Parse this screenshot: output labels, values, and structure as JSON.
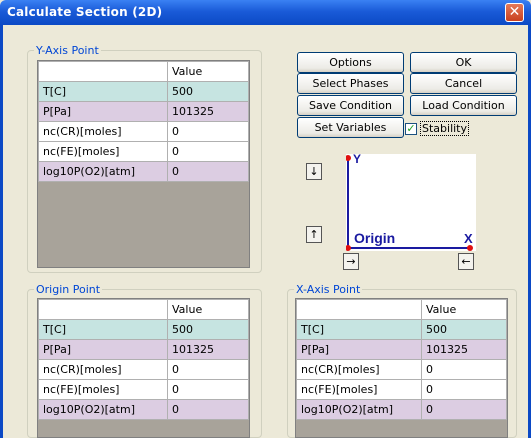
{
  "window": {
    "title": "Calculate Section (2D)",
    "close_glyph": "✕"
  },
  "y_axis_point": {
    "legend": "Y-Axis Point",
    "header": "Value",
    "rows": [
      {
        "label": "T[C]",
        "value": "500",
        "shade": "c"
      },
      {
        "label": "P[Pa]",
        "value": "101325",
        "shade": "m"
      },
      {
        "label": "nc(CR)[moles]",
        "value": "0",
        "shade": "w"
      },
      {
        "label": "nc(FE)[moles]",
        "value": "0",
        "shade": "w"
      },
      {
        "label": "log10P(O2)[atm]",
        "value": "0",
        "shade": "m"
      }
    ]
  },
  "origin_point": {
    "legend": "Origin Point",
    "header": "Value",
    "rows": [
      {
        "label": "T[C]",
        "value": "500",
        "shade": "c"
      },
      {
        "label": "P[Pa]",
        "value": "101325",
        "shade": "m"
      },
      {
        "label": "nc(CR)[moles]",
        "value": "0",
        "shade": "w"
      },
      {
        "label": "nc(FE)[moles]",
        "value": "0",
        "shade": "w"
      },
      {
        "label": "log10P(O2)[atm]",
        "value": "0",
        "shade": "m"
      }
    ]
  },
  "x_axis_point": {
    "legend": "X-Axis Point",
    "header": "Value",
    "rows": [
      {
        "label": "T[C]",
        "value": "500",
        "shade": "c"
      },
      {
        "label": "P[Pa]",
        "value": "101325",
        "shade": "m"
      },
      {
        "label": "nc(CR)[moles]",
        "value": "0",
        "shade": "w"
      },
      {
        "label": "nc(FE)[moles]",
        "value": "0",
        "shade": "w"
      },
      {
        "label": "log10P(O2)[atm]",
        "value": "0",
        "shade": "m"
      }
    ]
  },
  "buttons": {
    "options": "Options",
    "ok": "OK",
    "select_phases": "Select Phases",
    "cancel": "Cancel",
    "save_condition": "Save Condition",
    "load_condition": "Load Condition",
    "set_variables": "Set Variables"
  },
  "stability": {
    "label": "Stability",
    "checked": true,
    "check_glyph": "✓"
  },
  "axis_diagram": {
    "y_label": "Y",
    "x_label": "X",
    "origin_label": "Origin",
    "axis_color": "#1a1aa0",
    "point_color": "#e01010"
  },
  "arrows": {
    "down": "↓",
    "up": "↑",
    "right": "→",
    "left": "←"
  },
  "colors": {
    "title_bar": "#0b49c5",
    "group_legend": "#0046d5",
    "row_cyan": "#c6e4e1",
    "row_mauve": "#dccde2",
    "table_empty": "#a8a39a"
  }
}
